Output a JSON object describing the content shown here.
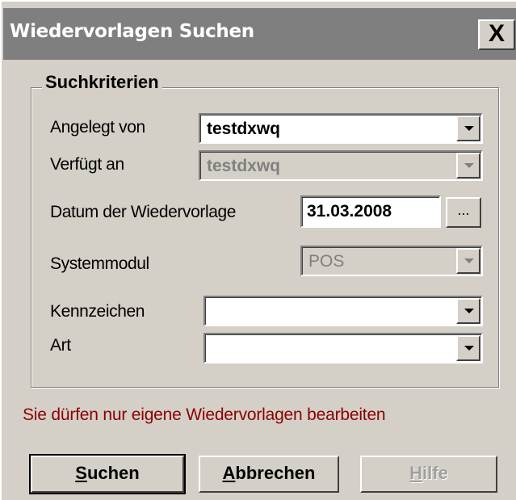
{
  "window": {
    "title": "Wiedervorlagen Suchen",
    "close_label": "X"
  },
  "groupbox": {
    "legend": "Suchkriterien"
  },
  "fields": {
    "angelegt_von": {
      "label": "Angelegt von",
      "value": "testdxwq"
    },
    "verfuegt_an": {
      "label": "Verfügt an",
      "value": "testdxwq"
    },
    "datum": {
      "label": "Datum der Wiedervorlage",
      "value": "31.03.2008",
      "button_label": "..."
    },
    "systemmodul": {
      "label": "Systemmodul",
      "value": "POS"
    },
    "kennzeichen": {
      "label": "Kennzeichen",
      "value": ""
    },
    "art": {
      "label": "Art",
      "value": ""
    }
  },
  "warning": "Sie dürfen nur eigene Wiedervorlagen bearbeiten",
  "buttons": {
    "suchen": {
      "accel": "S",
      "rest": "uchen"
    },
    "abbrechen": {
      "accel": "A",
      "rest": "bbrechen"
    },
    "hilfe": {
      "accel": "H",
      "rest": "ilfe"
    }
  },
  "colors": {
    "face": "#d4d0c8",
    "titlebar_inactive": "#7f7f7f",
    "warning_text": "#8b0000"
  },
  "icons": {
    "close": "close-icon",
    "dropdown": "chevron-down-icon"
  }
}
